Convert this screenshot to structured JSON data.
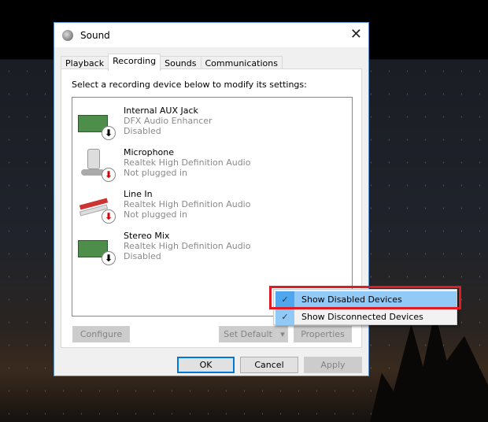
{
  "window": {
    "title": "Sound",
    "close_icon": "close-icon"
  },
  "tabs": [
    {
      "label": "Playback"
    },
    {
      "label": "Recording",
      "active": true
    },
    {
      "label": "Sounds"
    },
    {
      "label": "Communications"
    }
  ],
  "instruction": "Select a recording device below to modify its settings:",
  "devices": [
    {
      "name": "Internal AUX Jack",
      "driver": "DFX Audio Enhancer",
      "status": "Disabled",
      "icon": "sound-card-icon"
    },
    {
      "name": "Microphone",
      "driver": "Realtek High Definition Audio",
      "status": "Not plugged in",
      "icon": "microphone-icon"
    },
    {
      "name": "Line In",
      "driver": "Realtek High Definition Audio",
      "status": "Not plugged in",
      "icon": "line-in-cable-icon"
    },
    {
      "name": "Stereo Mix",
      "driver": "Realtek High Definition Audio",
      "status": "Disabled",
      "icon": "sound-card-icon"
    }
  ],
  "buttons": {
    "configure": "Configure",
    "set_default": "Set Default",
    "properties": "Properties",
    "ok": "OK",
    "cancel": "Cancel",
    "apply": "Apply"
  },
  "context_menu": [
    {
      "label": "Show Disabled Devices",
      "checked": true,
      "highlighted": true
    },
    {
      "label": "Show Disconnected Devices",
      "checked": true
    }
  ],
  "checkmark": "✓",
  "colors": {
    "highlight": "#91c9f7",
    "annotation_box": "#e01b24",
    "accent": "#0078d7"
  }
}
